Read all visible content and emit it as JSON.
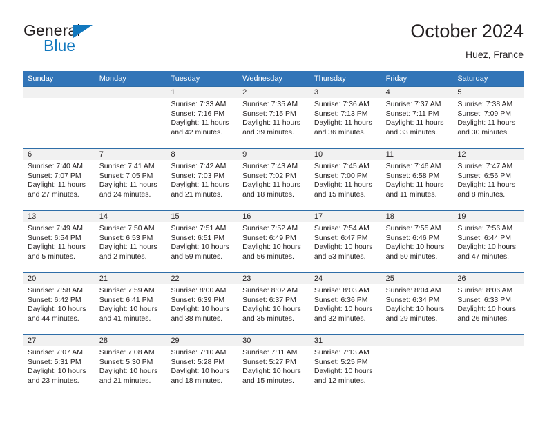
{
  "brand": {
    "name_top": "General",
    "name_bottom": "Blue",
    "triangle_icon": "blue-triangle-logo-icon",
    "accent_color": "#1278be"
  },
  "header": {
    "title": "October 2024",
    "subtitle": "Huez, France"
  },
  "theme": {
    "header_blue": "#3275b8",
    "daynum_band": "#f1f1f1",
    "text": "#231f20"
  },
  "calendar": {
    "weekdays": [
      "Sunday",
      "Monday",
      "Tuesday",
      "Wednesday",
      "Thursday",
      "Friday",
      "Saturday"
    ],
    "weeks": [
      [
        {
          "day": "",
          "sunrise": "",
          "sunset": "",
          "daylight": ""
        },
        {
          "day": "",
          "sunrise": "",
          "sunset": "",
          "daylight": ""
        },
        {
          "day": "1",
          "sunrise": "Sunrise: 7:33 AM",
          "sunset": "Sunset: 7:16 PM",
          "daylight": "Daylight: 11 hours and 42 minutes."
        },
        {
          "day": "2",
          "sunrise": "Sunrise: 7:35 AM",
          "sunset": "Sunset: 7:15 PM",
          "daylight": "Daylight: 11 hours and 39 minutes."
        },
        {
          "day": "3",
          "sunrise": "Sunrise: 7:36 AM",
          "sunset": "Sunset: 7:13 PM",
          "daylight": "Daylight: 11 hours and 36 minutes."
        },
        {
          "day": "4",
          "sunrise": "Sunrise: 7:37 AM",
          "sunset": "Sunset: 7:11 PM",
          "daylight": "Daylight: 11 hours and 33 minutes."
        },
        {
          "day": "5",
          "sunrise": "Sunrise: 7:38 AM",
          "sunset": "Sunset: 7:09 PM",
          "daylight": "Daylight: 11 hours and 30 minutes."
        }
      ],
      [
        {
          "day": "6",
          "sunrise": "Sunrise: 7:40 AM",
          "sunset": "Sunset: 7:07 PM",
          "daylight": "Daylight: 11 hours and 27 minutes."
        },
        {
          "day": "7",
          "sunrise": "Sunrise: 7:41 AM",
          "sunset": "Sunset: 7:05 PM",
          "daylight": "Daylight: 11 hours and 24 minutes."
        },
        {
          "day": "8",
          "sunrise": "Sunrise: 7:42 AM",
          "sunset": "Sunset: 7:03 PM",
          "daylight": "Daylight: 11 hours and 21 minutes."
        },
        {
          "day": "9",
          "sunrise": "Sunrise: 7:43 AM",
          "sunset": "Sunset: 7:02 PM",
          "daylight": "Daylight: 11 hours and 18 minutes."
        },
        {
          "day": "10",
          "sunrise": "Sunrise: 7:45 AM",
          "sunset": "Sunset: 7:00 PM",
          "daylight": "Daylight: 11 hours and 15 minutes."
        },
        {
          "day": "11",
          "sunrise": "Sunrise: 7:46 AM",
          "sunset": "Sunset: 6:58 PM",
          "daylight": "Daylight: 11 hours and 11 minutes."
        },
        {
          "day": "12",
          "sunrise": "Sunrise: 7:47 AM",
          "sunset": "Sunset: 6:56 PM",
          "daylight": "Daylight: 11 hours and 8 minutes."
        }
      ],
      [
        {
          "day": "13",
          "sunrise": "Sunrise: 7:49 AM",
          "sunset": "Sunset: 6:54 PM",
          "daylight": "Daylight: 11 hours and 5 minutes."
        },
        {
          "day": "14",
          "sunrise": "Sunrise: 7:50 AM",
          "sunset": "Sunset: 6:53 PM",
          "daylight": "Daylight: 11 hours and 2 minutes."
        },
        {
          "day": "15",
          "sunrise": "Sunrise: 7:51 AM",
          "sunset": "Sunset: 6:51 PM",
          "daylight": "Daylight: 10 hours and 59 minutes."
        },
        {
          "day": "16",
          "sunrise": "Sunrise: 7:52 AM",
          "sunset": "Sunset: 6:49 PM",
          "daylight": "Daylight: 10 hours and 56 minutes."
        },
        {
          "day": "17",
          "sunrise": "Sunrise: 7:54 AM",
          "sunset": "Sunset: 6:47 PM",
          "daylight": "Daylight: 10 hours and 53 minutes."
        },
        {
          "day": "18",
          "sunrise": "Sunrise: 7:55 AM",
          "sunset": "Sunset: 6:46 PM",
          "daylight": "Daylight: 10 hours and 50 minutes."
        },
        {
          "day": "19",
          "sunrise": "Sunrise: 7:56 AM",
          "sunset": "Sunset: 6:44 PM",
          "daylight": "Daylight: 10 hours and 47 minutes."
        }
      ],
      [
        {
          "day": "20",
          "sunrise": "Sunrise: 7:58 AM",
          "sunset": "Sunset: 6:42 PM",
          "daylight": "Daylight: 10 hours and 44 minutes."
        },
        {
          "day": "21",
          "sunrise": "Sunrise: 7:59 AM",
          "sunset": "Sunset: 6:41 PM",
          "daylight": "Daylight: 10 hours and 41 minutes."
        },
        {
          "day": "22",
          "sunrise": "Sunrise: 8:00 AM",
          "sunset": "Sunset: 6:39 PM",
          "daylight": "Daylight: 10 hours and 38 minutes."
        },
        {
          "day": "23",
          "sunrise": "Sunrise: 8:02 AM",
          "sunset": "Sunset: 6:37 PM",
          "daylight": "Daylight: 10 hours and 35 minutes."
        },
        {
          "day": "24",
          "sunrise": "Sunrise: 8:03 AM",
          "sunset": "Sunset: 6:36 PM",
          "daylight": "Daylight: 10 hours and 32 minutes."
        },
        {
          "day": "25",
          "sunrise": "Sunrise: 8:04 AM",
          "sunset": "Sunset: 6:34 PM",
          "daylight": "Daylight: 10 hours and 29 minutes."
        },
        {
          "day": "26",
          "sunrise": "Sunrise: 8:06 AM",
          "sunset": "Sunset: 6:33 PM",
          "daylight": "Daylight: 10 hours and 26 minutes."
        }
      ],
      [
        {
          "day": "27",
          "sunrise": "Sunrise: 7:07 AM",
          "sunset": "Sunset: 5:31 PM",
          "daylight": "Daylight: 10 hours and 23 minutes."
        },
        {
          "day": "28",
          "sunrise": "Sunrise: 7:08 AM",
          "sunset": "Sunset: 5:30 PM",
          "daylight": "Daylight: 10 hours and 21 minutes."
        },
        {
          "day": "29",
          "sunrise": "Sunrise: 7:10 AM",
          "sunset": "Sunset: 5:28 PM",
          "daylight": "Daylight: 10 hours and 18 minutes."
        },
        {
          "day": "30",
          "sunrise": "Sunrise: 7:11 AM",
          "sunset": "Sunset: 5:27 PM",
          "daylight": "Daylight: 10 hours and 15 minutes."
        },
        {
          "day": "31",
          "sunrise": "Sunrise: 7:13 AM",
          "sunset": "Sunset: 5:25 PM",
          "daylight": "Daylight: 10 hours and 12 minutes."
        },
        {
          "day": "",
          "sunrise": "",
          "sunset": "",
          "daylight": ""
        },
        {
          "day": "",
          "sunrise": "",
          "sunset": "",
          "daylight": ""
        }
      ]
    ]
  }
}
